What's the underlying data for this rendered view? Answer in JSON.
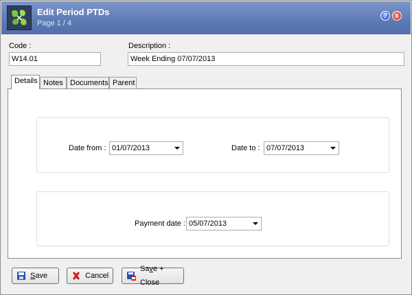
{
  "window": {
    "title": "Edit Period PTDs",
    "subtitle": "Page 1 / 4",
    "help_symbol": "?",
    "close_symbol": "x"
  },
  "form": {
    "code_label": "Code :",
    "code_value": "W14.01",
    "description_label": "Description :",
    "description_value": "Week Ending 07/07/2013"
  },
  "tabs": [
    {
      "label": "Details",
      "active": true
    },
    {
      "label": "Notes"
    },
    {
      "label": "Documents"
    },
    {
      "label": "Parent"
    }
  ],
  "details": {
    "date_from_label": "Date from :",
    "date_from_value": "01/07/2013",
    "date_to_label": "Date to :",
    "date_to_value": "07/07/2013",
    "payment_date_label": "Payment date :",
    "payment_date_value": "05/07/2013"
  },
  "buttons": {
    "save_first": "S",
    "save_rest": "ave",
    "cancel_label": "Cancel",
    "save_close_pre": "Sa",
    "save_close_ul": "v",
    "save_close_post": "e + Close"
  },
  "colors": {
    "banner": "#5d7ab4",
    "save_icon": "#2a4fb0",
    "cancel_icon": "#d02020"
  }
}
